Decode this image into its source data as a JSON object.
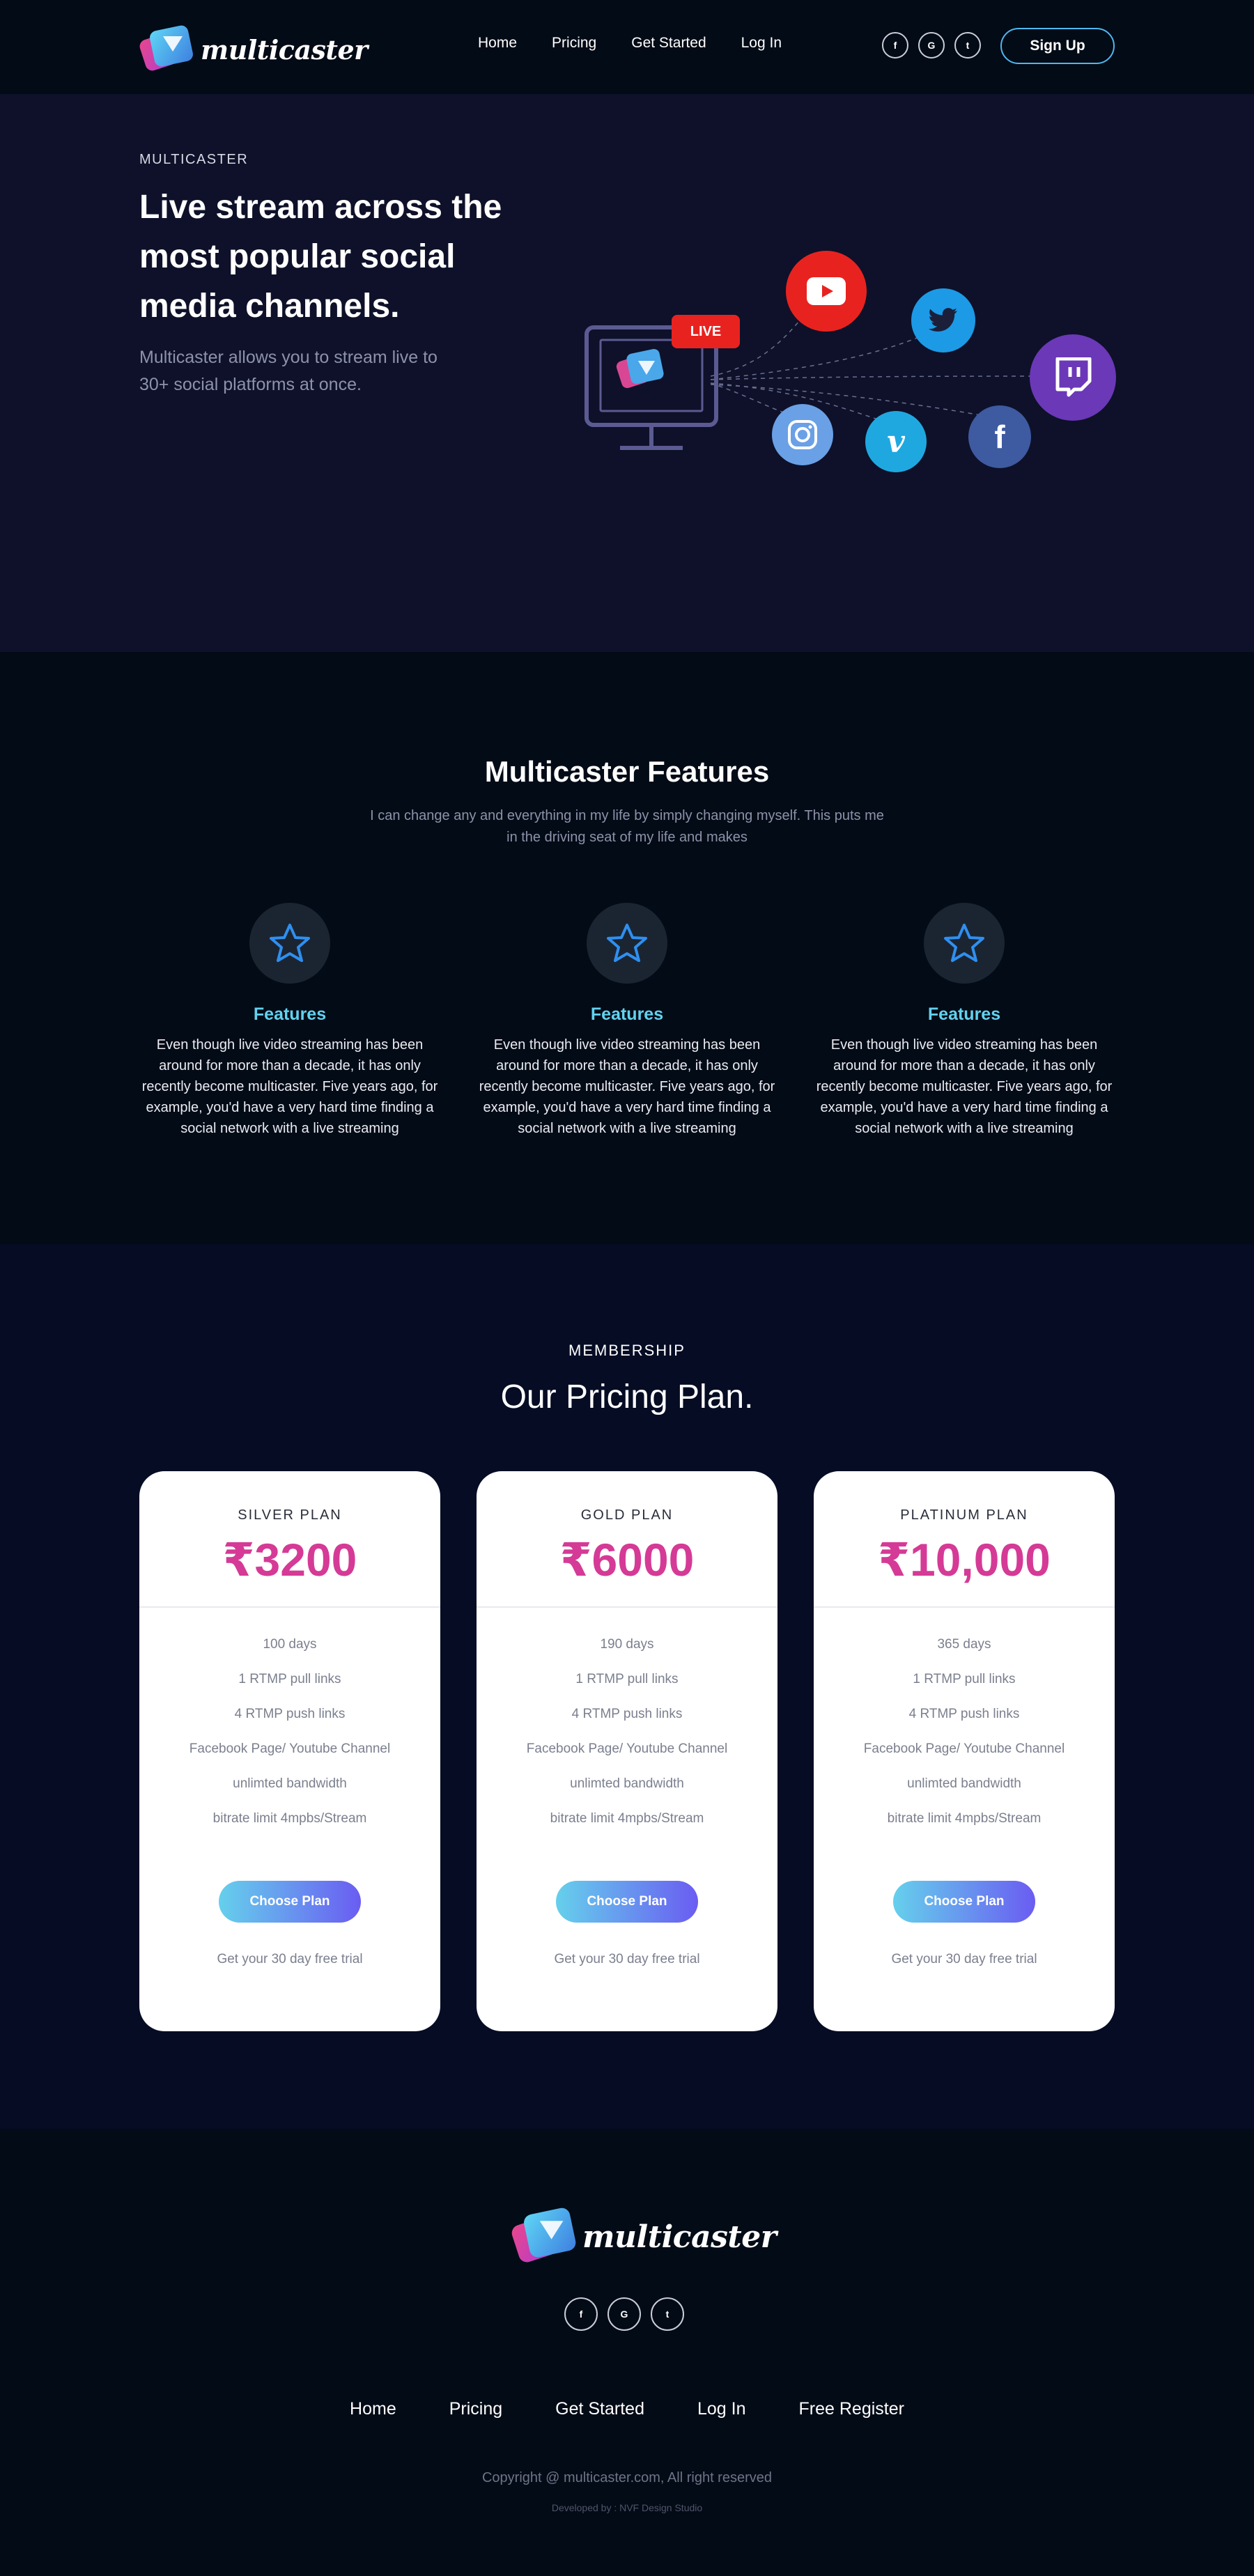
{
  "brand": {
    "name": "multicaster"
  },
  "nav": {
    "links": [
      "Home",
      "Pricing",
      "Get Started",
      "Log In"
    ],
    "social": [
      "f",
      "G",
      "t"
    ],
    "signup_label": "Sign Up"
  },
  "hero": {
    "eyebrow": "MULTICASTER",
    "title": "Live stream across the most popular social media channels.",
    "subtitle": "Multicaster allows you to stream live to 30+ social platforms at once.",
    "live_badge": "LIVE",
    "platforms": [
      "youtube-icon",
      "twitter-icon",
      "twitch-icon",
      "instagram-icon",
      "vimeo-icon",
      "facebook-icon"
    ]
  },
  "features": {
    "title": "Multicaster Features",
    "subtitle": "I can change any and everything in my life by simply changing myself. This puts me in the driving seat of my life and makes",
    "items": [
      {
        "name": "Features",
        "text": "Even though live video streaming has been around for more than a decade, it has only recently become multicaster. Five years ago, for example, you'd have a very hard time finding a social network with a live streaming"
      },
      {
        "name": "Features",
        "text": "Even though live video streaming has been around for more than a decade, it has only recently become multicaster. Five years ago, for example, you'd have a very hard time finding a social network with a live streaming"
      },
      {
        "name": "Features",
        "text": "Even though live video streaming has been around for more than a decade, it has only recently become multicaster. Five years ago, for example, you'd have a very hard time finding a social network with a live streaming"
      }
    ]
  },
  "pricing": {
    "eyebrow": "MEMBERSHIP",
    "title": "Our Pricing Plan.",
    "plans": [
      {
        "name": "SILVER PLAN",
        "price": "₹3200",
        "features": [
          "100 days",
          "1 RTMP pull links",
          "4 RTMP push links",
          "Facebook Page/ Youtube Channel",
          "unlimted bandwidth",
          "bitrate limit 4mpbs/Stream"
        ],
        "cta": "Choose Plan",
        "trial": "Get your 30 day free trial"
      },
      {
        "name": "GOLD PLAN",
        "price": "₹6000",
        "features": [
          "190 days",
          "1 RTMP pull links",
          "4 RTMP push links",
          "Facebook Page/ Youtube Channel",
          "unlimted bandwidth",
          "bitrate limit 4mpbs/Stream"
        ],
        "cta": "Choose Plan",
        "trial": "Get your 30 day free trial"
      },
      {
        "name": "PLATINUM PLAN",
        "price": "₹10,000",
        "features": [
          "365 days",
          "1 RTMP pull links",
          "4 RTMP push links",
          "Facebook Page/ Youtube Channel",
          "unlimted bandwidth",
          "bitrate limit 4mpbs/Stream"
        ],
        "cta": "Choose Plan",
        "trial": "Get your 30 day free trial"
      }
    ]
  },
  "footer": {
    "social": [
      "f",
      "G",
      "t"
    ],
    "links": [
      "Home",
      "Pricing",
      "Get Started",
      "Log In",
      "Free Register"
    ],
    "copyright": "Copyright @ multicaster.com, All right reserved",
    "developer": "Developed by : NVF Design Studio"
  },
  "colors": {
    "accent_cyan": "#62d2ef",
    "price_magenta": "#d53a96",
    "hero_bg": "#0e1129",
    "page_bg": "#030b16"
  }
}
